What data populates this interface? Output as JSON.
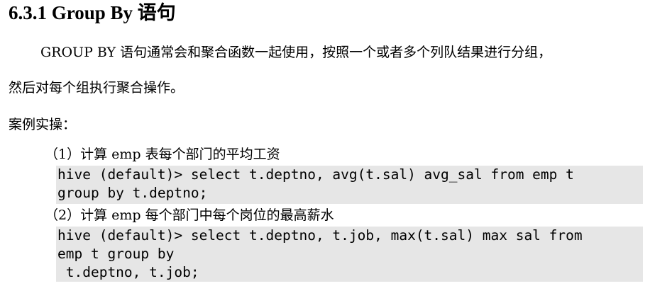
{
  "heading": "6.3.1 Group By 语句",
  "paragraphs": {
    "intro_line1": "GROUP BY 语句通常会和聚合函数一起使用，按照一个或者多个列队结果进行分组，",
    "intro_line2": "然后对每个组执行聚合操作。",
    "case_label": "案例实操："
  },
  "steps": [
    {
      "title": "（1）计算 emp 表每个部门的平均工资",
      "code_lines": [
        "hive (default)> select t.deptno, avg(t.sal) avg_sal from emp t",
        "group by t.deptno;"
      ]
    },
    {
      "title": "（2）计算 emp 每个部门中每个岗位的最高薪水",
      "code_lines": [
        "hive (default)> select t.deptno, t.job, max(t.sal) max sal from",
        "emp t group by",
        " t.deptno, t.job;"
      ]
    }
  ]
}
